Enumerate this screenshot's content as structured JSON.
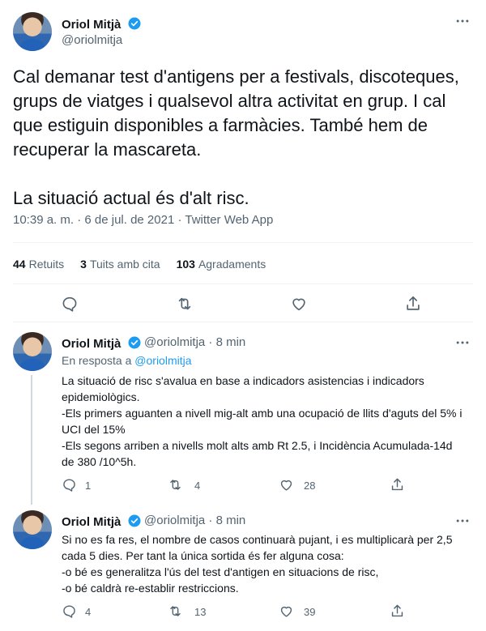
{
  "main": {
    "author_name": "Oriol Mitjà",
    "author_handle": "@oriolmitja",
    "text": "Cal demanar test d'antigens per a festivals, discoteques, grups de viatges i qualsevol altra activitat en grup. I cal que estiguin disponibles a farmàcies. També hem de recuperar la mascareta.\n\nLa situació actual és d'alt risc.",
    "meta": "10:39 a. m. · 6 de jul. de 2021 · Twitter Web App",
    "stats": {
      "retweets_count": "44",
      "retweets_label": "Retuits",
      "quotes_count": "3",
      "quotes_label": "Tuits amb cita",
      "likes_count": "103",
      "likes_label": "Agradaments"
    }
  },
  "replies": [
    {
      "author_name": "Oriol Mitjà",
      "author_handle": "@oriolmitja · 8 min",
      "in_reply_prefix": "En resposta a",
      "in_reply_handle": "@oriolmitja",
      "text": "La situació de risc s'avalua en base a indicadors asistencias i indicadors epidemiològics.\n-Els primers aguanten a nivell mig-alt amb una ocupació de llits d'aguts del 5% i UCI del 15%\n-Els segons arriben a nivells molt alts amb Rt 2.5, i Incidència Acumulada-14d de 380 /10^5h.",
      "replies": "1",
      "retweets": "4",
      "likes": "28"
    },
    {
      "author_name": "Oriol Mitjà",
      "author_handle": "@oriolmitja · 8 min",
      "text": "Si no es fa res, el nombre de casos continuarà pujant, i es multiplicarà per 2,5 cada 5 dies. Per tant la única sortida és fer alguna cosa:\n-o bé es generalitza l'ús del test d'antigen en situacions de risc,\n-o bé caldrà re-establir restriccions.",
      "replies": "4",
      "retweets": "13",
      "likes": "39"
    }
  ],
  "icons": {
    "reply": "reply-icon",
    "retweet": "retweet-icon",
    "like": "heart-icon",
    "share": "share-icon",
    "more": "more-icon",
    "verified": "verified-badge-icon"
  },
  "colors": {
    "accent": "#1d9bf0",
    "text": "#0f1419",
    "secondary": "#536471",
    "divider": "#eff3f4"
  }
}
